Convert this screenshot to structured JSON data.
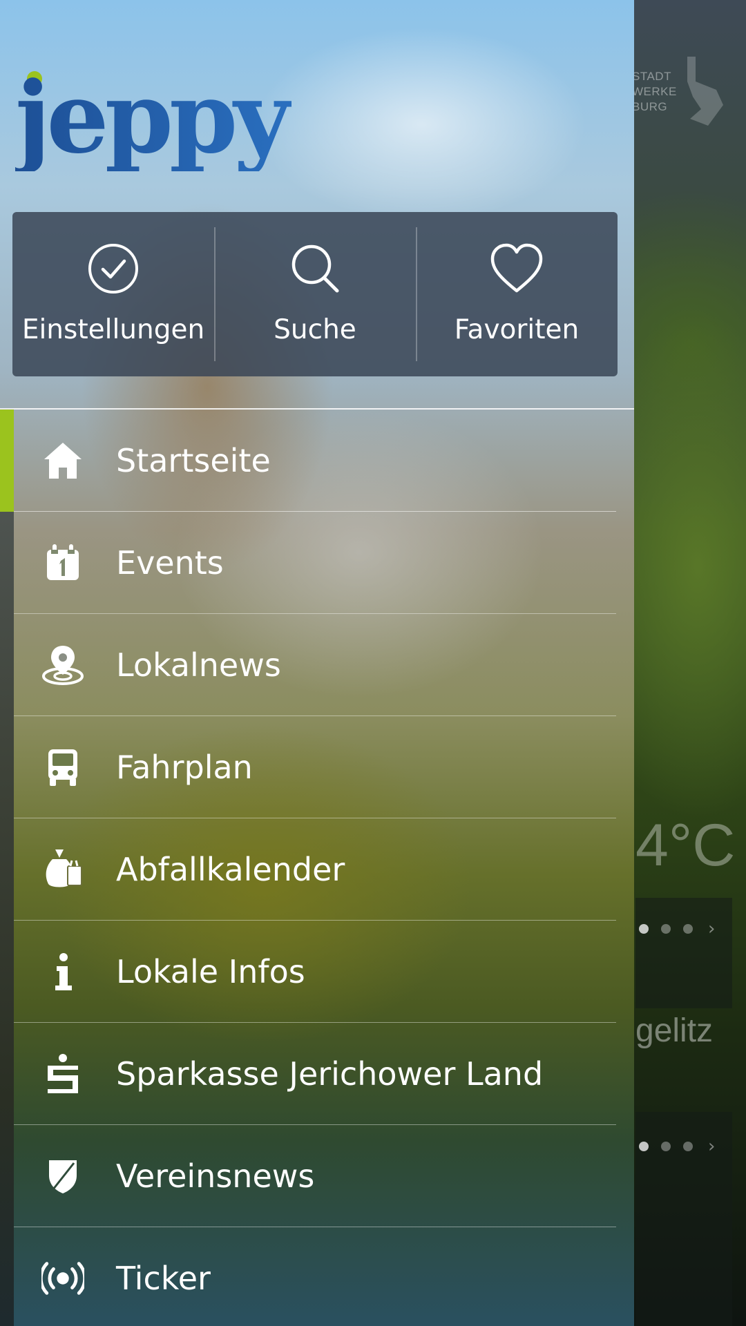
{
  "app": {
    "logo_text": "jeppy",
    "brand_colors": {
      "accent": "#9bc31e",
      "logo_blue": "#1f5fa8"
    }
  },
  "quick_actions": [
    {
      "label": "Einstellungen",
      "icon": "check-circle-icon"
    },
    {
      "label": "Suche",
      "icon": "search-icon"
    },
    {
      "label": "Favoriten",
      "icon": "heart-icon"
    }
  ],
  "menu": {
    "active_index": 0,
    "items": [
      {
        "label": "Startseite",
        "icon": "home-icon"
      },
      {
        "label": "Events",
        "icon": "calendar-icon"
      },
      {
        "label": "Lokalnews",
        "icon": "location-pin-icon"
      },
      {
        "label": "Fahrplan",
        "icon": "bus-icon"
      },
      {
        "label": "Abfallkalender",
        "icon": "trash-bag-icon"
      },
      {
        "label": "Lokale Infos",
        "icon": "info-icon"
      },
      {
        "label": "Sparkasse Jerichower Land",
        "icon": "sparkasse-icon"
      },
      {
        "label": "Vereinsnews",
        "icon": "shield-icon"
      },
      {
        "label": "Ticker",
        "icon": "broadcast-icon"
      }
    ]
  },
  "background": {
    "partner_logo_lines": [
      "STADT",
      "WERKE",
      "BURG"
    ],
    "temperature": "4°C",
    "town_fragment": "gelitz"
  }
}
